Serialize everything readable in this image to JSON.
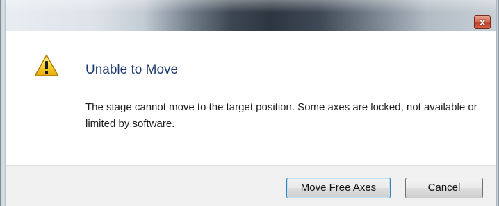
{
  "window": {
    "close_glyph": "x",
    "close_icon": "close-icon"
  },
  "dialog": {
    "icon": "warning-icon",
    "icon_color": "#f5c518",
    "title": "Unable to Move",
    "message": "The stage cannot move to the target position. Some axes are locked, not available or limited by software."
  },
  "buttons": {
    "move_free_axes_label": "Move Free Axes",
    "cancel_label": "Cancel"
  }
}
